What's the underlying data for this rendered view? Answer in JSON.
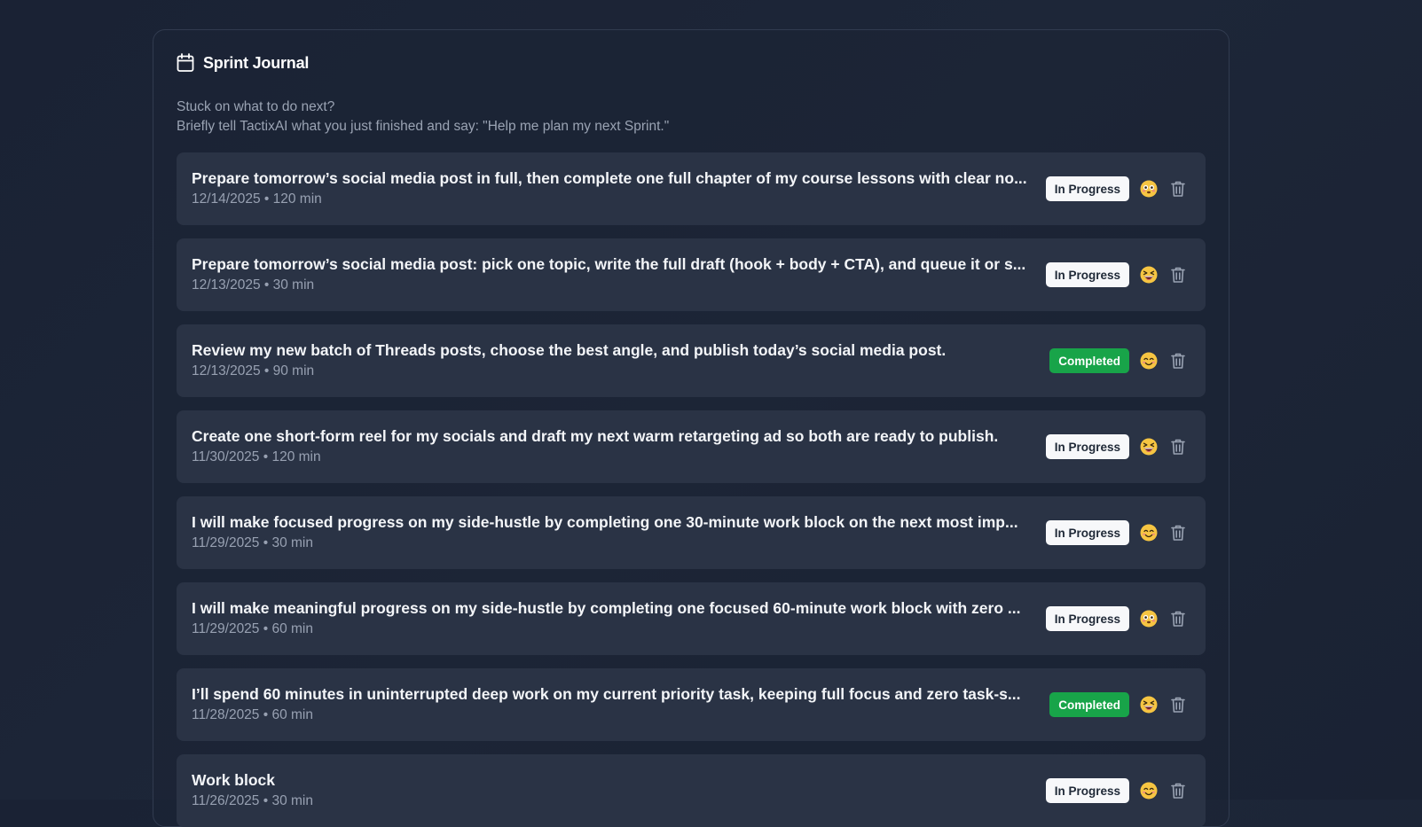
{
  "journal": {
    "title": "Sprint Journal",
    "hint_line1": "Stuck on what to do next?",
    "hint_line2": "Briefly tell TactixAI what you just finished and say: \"Help me plan my next Sprint.\""
  },
  "colors": {
    "in_progress_badge": "#f7f8fa",
    "completed_badge": "#18a449",
    "card": "#2a3345"
  },
  "entries": [
    {
      "title": "Prepare tomorrow’s social media post in full, then complete one full chapter of my course lessons with clear no...",
      "meta": "12/14/2025 • 120 min",
      "status": "In Progress",
      "mood_icon": "flushed-face-icon"
    },
    {
      "title": "Prepare tomorrow’s social media post: pick one topic, write the full draft (hook + body + CTA), and queue it or s...",
      "meta": "12/13/2025 • 30 min",
      "status": "In Progress",
      "mood_icon": "grinning-squinting-face-icon"
    },
    {
      "title": "Review my new batch of Threads posts, choose the best angle, and publish today’s social media post.",
      "meta": "12/13/2025 • 90 min",
      "status": "Completed",
      "mood_icon": "smiling-face-icon"
    },
    {
      "title": "Create one short-form reel for my socials and draft my next warm retargeting ad so both are ready to publish.",
      "meta": "11/30/2025 • 120 min",
      "status": "In Progress",
      "mood_icon": "grinning-squinting-face-icon"
    },
    {
      "title": "I will make focused progress on my side-hustle by completing one 30-minute work block on the next most imp...",
      "meta": "11/29/2025 • 30 min",
      "status": "In Progress",
      "mood_icon": "smiling-face-icon"
    },
    {
      "title": "I will make meaningful progress on my side-hustle by completing one focused 60-minute work block with zero ...",
      "meta": "11/29/2025 • 60 min",
      "status": "In Progress",
      "mood_icon": "flushed-face-icon"
    },
    {
      "title": "I’ll spend 60 minutes in uninterrupted deep work on my current priority task, keeping full focus and zero task-s...",
      "meta": "11/28/2025 • 60 min",
      "status": "Completed",
      "mood_icon": "grinning-squinting-face-icon"
    },
    {
      "title": "Work block",
      "meta": "11/26/2025 • 30 min",
      "status": "In Progress",
      "mood_icon": "smiling-face-icon"
    }
  ]
}
